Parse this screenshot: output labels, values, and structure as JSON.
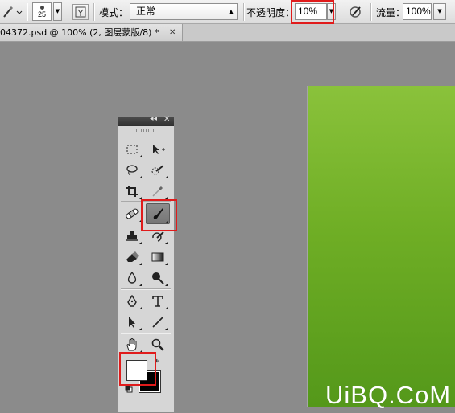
{
  "options_bar": {
    "brush_size": "25",
    "mode_label": "模式：",
    "mode_value": "正常",
    "opacity_label": "不透明度：",
    "opacity_value": "10%",
    "flow_label": "流量：",
    "flow_value": "100%"
  },
  "document_tab": {
    "title": "04372.psd @ 100% (2, 图层蒙版/8) *"
  },
  "tools_panel": {
    "tools": [
      "rectangular-marquee",
      "move",
      "lasso",
      "quick-selection",
      "crop",
      "eyedropper",
      "spot-healing-brush",
      "brush",
      "clone-stamp",
      "history-brush",
      "eraser",
      "gradient",
      "blur",
      "dodge",
      "pen",
      "type",
      "path-selection",
      "line",
      "hand",
      "zoom"
    ],
    "active_tool": "brush",
    "foreground_color": "#ffffff",
    "background_color": "#000000"
  },
  "canvas": {
    "fill_colors": [
      "#8ac23b",
      "#54981a"
    ]
  },
  "highlight_color": "#e01b1b",
  "watermark": "UiBQ.CoM"
}
